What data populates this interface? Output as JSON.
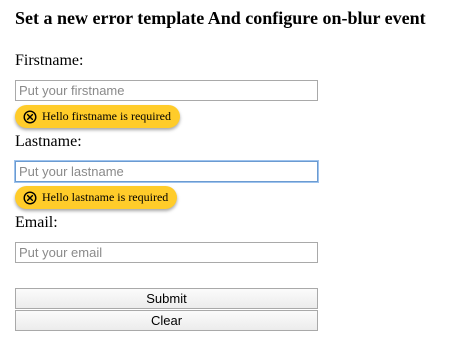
{
  "page": {
    "title": "Set a new error template And configure on-blur event"
  },
  "form": {
    "firstname": {
      "label": "Firstname:",
      "value": "",
      "placeholder": "Put your firstname",
      "error": "Hello firstname is required"
    },
    "lastname": {
      "label": "Lastname:",
      "value": "",
      "placeholder": "Put your lastname",
      "error": "Hello lastname is required"
    },
    "email": {
      "label": "Email:",
      "value": "",
      "placeholder": "Put your email"
    },
    "submit_label": "Submit",
    "clear_label": "Clear"
  },
  "style": {
    "error_bg": "#ffcc2a",
    "focus_border": "#6b9bd1",
    "error_icon": "close-circle-icon"
  }
}
